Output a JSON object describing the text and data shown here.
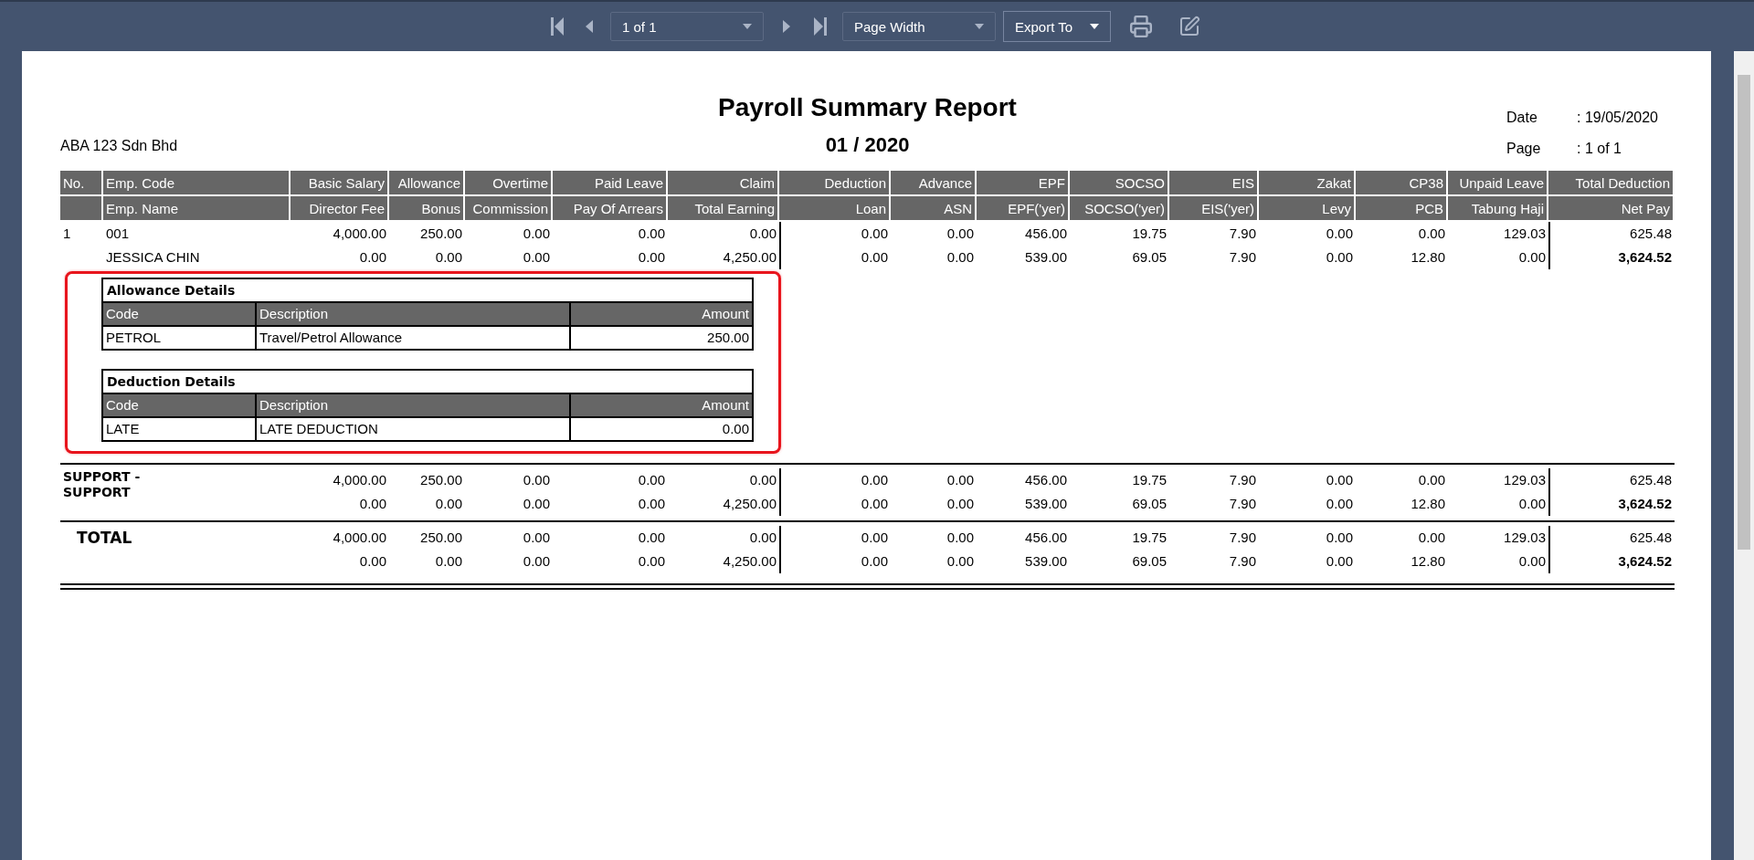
{
  "toolbar": {
    "page_selector": "1 of 1",
    "zoom_selector": "Page Width",
    "export_button": "Export To"
  },
  "report": {
    "title": "Payroll Summary Report",
    "period": "01 / 2020",
    "company": "ABA 123 Sdn Bhd",
    "date_label": "Date",
    "date_value": ": 19/05/2020",
    "page_label": "Page",
    "page_value": ": 1 of 1"
  },
  "table": {
    "columns": [
      {
        "top": "No."
      },
      {
        "top": "Emp. Code",
        "bottom": "Emp. Name"
      },
      {
        "top": "Basic Salary",
        "bottom": "Director Fee"
      },
      {
        "top": "Allowance",
        "bottom": "Bonus"
      },
      {
        "top": "Overtime",
        "bottom": "Commission"
      },
      {
        "top": "Paid Leave",
        "bottom": "Pay Of Arrears"
      },
      {
        "top": "Claim",
        "bottom": "Total Earning"
      },
      {
        "top": "Deduction",
        "bottom": "Loan"
      },
      {
        "top": "Advance",
        "bottom": "ASN"
      },
      {
        "top": "EPF",
        "bottom": "EPF('yer)"
      },
      {
        "top": "SOCSO",
        "bottom": "SOCSO('yer)"
      },
      {
        "top": "EIS",
        "bottom": "EIS('yer)"
      },
      {
        "top": "Zakat",
        "bottom": "Levy"
      },
      {
        "top": "CP38",
        "bottom": "PCB"
      },
      {
        "top": "Unpaid Leave",
        "bottom": "Tabung Haji"
      },
      {
        "top": "Total Deduction",
        "bottom": "Net Pay"
      }
    ],
    "employees": [
      {
        "no": "1",
        "code": "001",
        "name": "JESSICA CHIN",
        "line1": [
          "4,000.00",
          "250.00",
          "0.00",
          "0.00",
          "0.00",
          "0.00",
          "0.00",
          "456.00",
          "19.75",
          "7.90",
          "0.00",
          "0.00",
          "129.03",
          "625.48"
        ],
        "line2": [
          "0.00",
          "0.00",
          "0.00",
          "0.00",
          "4,250.00",
          "0.00",
          "0.00",
          "539.00",
          "69.05",
          "7.90",
          "0.00",
          "12.80",
          "0.00",
          "3,624.52"
        ]
      }
    ],
    "details": [
      {
        "title": "Allowance Details",
        "columns": [
          "Code",
          "Description",
          "Amount"
        ],
        "rows": [
          [
            "PETROL",
            "Travel/Petrol Allowance",
            "250.00"
          ]
        ]
      },
      {
        "title": "Deduction Details",
        "columns": [
          "Code",
          "Description",
          "Amount"
        ],
        "rows": [
          [
            "LATE",
            "LATE DEDUCTION",
            "0.00"
          ]
        ]
      }
    ],
    "groups": [
      {
        "kind": "subtotal",
        "label": "SUPPORT - SUPPORT",
        "line1": [
          "4,000.00",
          "250.00",
          "0.00",
          "0.00",
          "0.00",
          "0.00",
          "0.00",
          "456.00",
          "19.75",
          "7.90",
          "0.00",
          "0.00",
          "129.03",
          "625.48"
        ],
        "line2": [
          "0.00",
          "0.00",
          "0.00",
          "0.00",
          "4,250.00",
          "0.00",
          "0.00",
          "539.00",
          "69.05",
          "7.90",
          "0.00",
          "12.80",
          "0.00",
          "3,624.52"
        ]
      },
      {
        "kind": "total",
        "label": "TOTAL",
        "line1": [
          "4,000.00",
          "250.00",
          "0.00",
          "0.00",
          "0.00",
          "0.00",
          "0.00",
          "456.00",
          "19.75",
          "7.90",
          "0.00",
          "0.00",
          "129.03",
          "625.48"
        ],
        "line2": [
          "0.00",
          "0.00",
          "0.00",
          "0.00",
          "4,250.00",
          "0.00",
          "0.00",
          "539.00",
          "69.05",
          "7.90",
          "0.00",
          "12.80",
          "0.00",
          "3,624.52"
        ]
      }
    ]
  }
}
